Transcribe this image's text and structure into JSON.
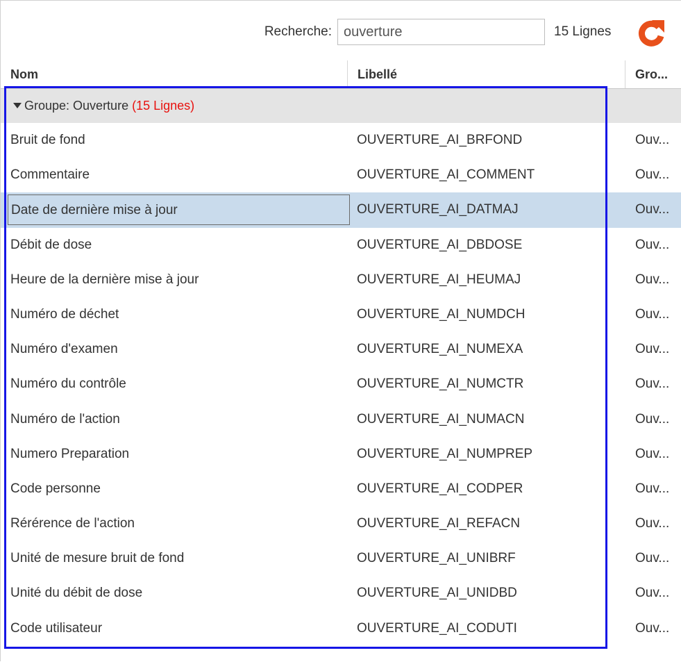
{
  "toolbar": {
    "search_label": "Recherche:",
    "search_value": "ouverture",
    "row_count": "15 Lignes",
    "refresh_color": "#e8501b"
  },
  "columns": {
    "nom": "Nom",
    "libelle": "Libellé",
    "groupe": "Gro..."
  },
  "group": {
    "label": "Groupe: Ouverture",
    "count": "(15 Lignes)",
    "count_color": "#e8110e"
  },
  "rows": [
    {
      "nom": "Bruit de fond",
      "libelle": "OUVERTURE_AI_BRFOND",
      "groupe": "Ouv..."
    },
    {
      "nom": "Commentaire",
      "libelle": "OUVERTURE_AI_COMMENT",
      "groupe": "Ouv..."
    },
    {
      "nom": "Date de dernière mise à jour",
      "libelle": "OUVERTURE_AI_DATMAJ",
      "groupe": "Ouv...",
      "selected": true
    },
    {
      "nom": "Débit de dose",
      "libelle": "OUVERTURE_AI_DBDOSE",
      "groupe": "Ouv..."
    },
    {
      "nom": "Heure de la dernière mise à jour",
      "libelle": "OUVERTURE_AI_HEUMAJ",
      "groupe": "Ouv..."
    },
    {
      "nom": "Numéro de déchet",
      "libelle": "OUVERTURE_AI_NUMDCH",
      "groupe": "Ouv..."
    },
    {
      "nom": "Numéro d'examen",
      "libelle": "OUVERTURE_AI_NUMEXA",
      "groupe": "Ouv..."
    },
    {
      "nom": "Numéro du contrôle",
      "libelle": "OUVERTURE_AI_NUMCTR",
      "groupe": "Ouv..."
    },
    {
      "nom": "Numéro de l'action",
      "libelle": "OUVERTURE_AI_NUMACN",
      "groupe": "Ouv..."
    },
    {
      "nom": "Numero Preparation",
      "libelle": "OUVERTURE_AI_NUMPREP",
      "groupe": "Ouv..."
    },
    {
      "nom": "Code personne",
      "libelle": "OUVERTURE_AI_CODPER",
      "groupe": "Ouv..."
    },
    {
      "nom": "Rérérence de l'action",
      "libelle": "OUVERTURE_AI_REFACN",
      "groupe": "Ouv..."
    },
    {
      "nom": "Unité de mesure bruit de fond",
      "libelle": "OUVERTURE_AI_UNIBRF",
      "groupe": "Ouv..."
    },
    {
      "nom": "Unité du débit de dose",
      "libelle": "OUVERTURE_AI_UNIDBD",
      "groupe": "Ouv..."
    },
    {
      "nom": "Code utilisateur",
      "libelle": "OUVERTURE_AI_CODUTI",
      "groupe": "Ouv..."
    }
  ],
  "colors": {
    "selected_row": "#c9dbec",
    "group_header_bg": "#e4e4e4",
    "annotation_box": "#1616e6"
  }
}
